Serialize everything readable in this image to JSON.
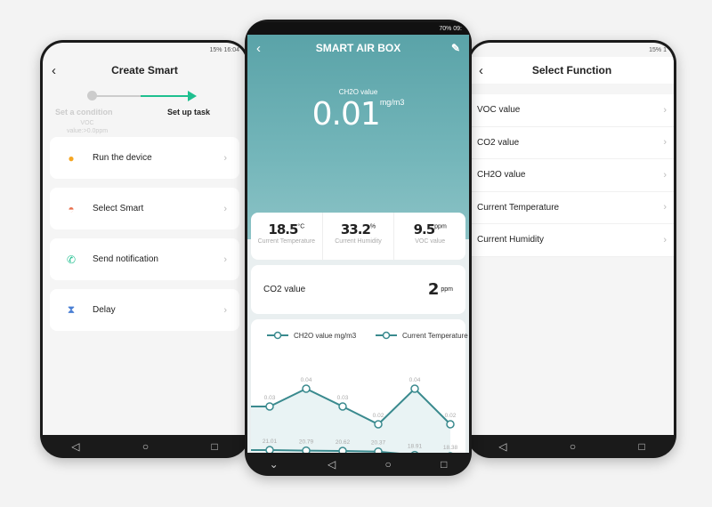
{
  "left": {
    "status": "15% 16:04",
    "title": "Create Smart",
    "step1": "Set a condition",
    "step1_detail_1": "VOC",
    "step1_detail_2": "value:>0.0ppm",
    "step2": "Set up task",
    "accent": "#1fbf8f",
    "items": [
      {
        "label": "Run the device",
        "icon": "bulb-icon"
      },
      {
        "label": "Select Smart",
        "icon": "sunrise-icon"
      },
      {
        "label": "Send notification",
        "icon": "phone-message-icon"
      },
      {
        "label": "Delay",
        "icon": "hourglass-icon"
      }
    ]
  },
  "mid": {
    "status": "70% 09:",
    "title": "SMART AIR BOX",
    "main_label": "CH2O value",
    "main_value": "0.01",
    "main_unit": "mg/m3",
    "stats": [
      {
        "value": "18.5",
        "unit": "°C",
        "label": "Current Temperature"
      },
      {
        "value": "33.2",
        "unit": "%",
        "label": "Current Humidity"
      },
      {
        "value": "9.5",
        "unit": "ppm",
        "label": "VOC value"
      }
    ],
    "co2": {
      "label": "CO2 value",
      "value": "2",
      "unit": "ppm"
    },
    "theme": "#5aa3a8"
  },
  "chart_data": {
    "type": "line",
    "series": [
      {
        "name": "CH2O value mg/m3",
        "values": [
          0.03,
          0.04,
          0.03,
          0.02,
          0.04,
          0.02
        ],
        "labels": [
          "0.03",
          "0.04",
          "0.03",
          "0.02",
          "0.04",
          "0.02"
        ]
      },
      {
        "name": "Current Temperature",
        "values": [
          21.01,
          20.79,
          20.62,
          20.37,
          18.91,
          18.38
        ],
        "labels": [
          "21.01",
          "20.79",
          "20.62",
          "20.37",
          "18.91",
          "18.38"
        ]
      }
    ],
    "color": "#3a8a8e",
    "grid": false,
    "legend": "top"
  },
  "right": {
    "status": "15% 1",
    "title": "Select Function",
    "items": [
      "VOC value",
      "CO2 value",
      "CH2O value",
      "Current Temperature",
      "Current Humidity"
    ]
  }
}
